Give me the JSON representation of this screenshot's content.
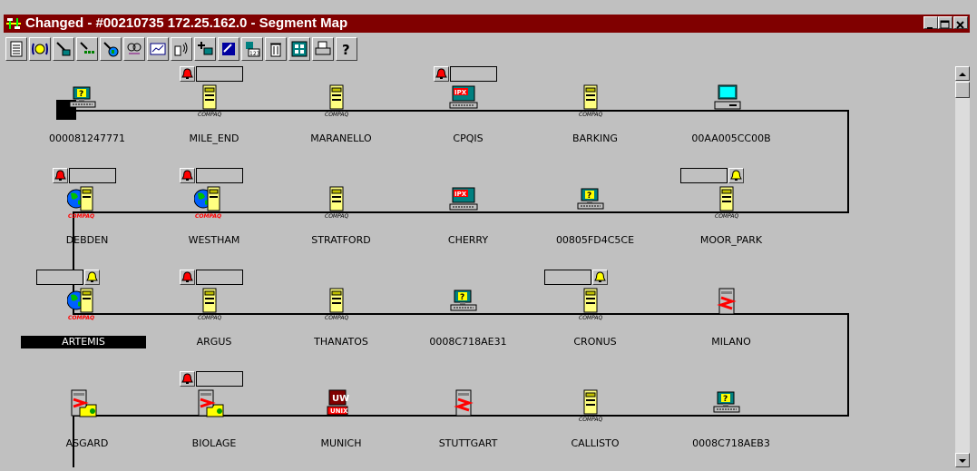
{
  "window": {
    "title": "Changed - #00210735 172.25.162.0 - Segment Map",
    "title_icon": "segment-map-icon",
    "controls": [
      "minimize-icon",
      "maximize-icon",
      "close-icon"
    ]
  },
  "toolbar": {
    "buttons": [
      {
        "icon": "list-icon"
      },
      {
        "icon": "broadcast-icon"
      },
      {
        "icon": "ping-icon"
      },
      {
        "icon": "network-probe-icon"
      },
      {
        "icon": "globe-probe-icon"
      },
      {
        "icon": "discover-icon"
      },
      {
        "icon": "graph-icon"
      },
      {
        "icon": "wireless-device-icon"
      },
      {
        "icon": "add-node-icon"
      },
      {
        "icon": "edit-icon"
      },
      {
        "icon": "numbered-node-icon"
      },
      {
        "icon": "trash-icon"
      },
      {
        "icon": "map-view-icon"
      },
      {
        "icon": "print-icon"
      },
      {
        "icon": "help-icon"
      }
    ]
  },
  "segment": {
    "nodes": [
      {
        "name": "000081247771",
        "icon": "unknown-pc-icon",
        "alarm": "none"
      },
      {
        "name": "MILE_END",
        "icon": "compaq-server-icon",
        "alarm": "red"
      },
      {
        "name": "MARANELLO",
        "icon": "compaq-server-icon",
        "alarm": "none"
      },
      {
        "name": "CPQIS",
        "icon": "ipx-workstation-icon",
        "alarm": "red"
      },
      {
        "name": "BARKING",
        "icon": "compaq-server-icon",
        "alarm": "none"
      },
      {
        "name": "00AA005CC00B",
        "icon": "desktop-pc-icon",
        "alarm": "none"
      },
      {
        "name": "DEBDEN",
        "icon": "compaq-globe-server-icon",
        "alarm": "red"
      },
      {
        "name": "WESTHAM",
        "icon": "compaq-globe-server-icon",
        "alarm": "red"
      },
      {
        "name": "STRATFORD",
        "icon": "compaq-server-icon",
        "alarm": "none"
      },
      {
        "name": "CHERRY",
        "icon": "ipx-workstation-icon",
        "alarm": "none"
      },
      {
        "name": "00805FD4C5CE",
        "icon": "unknown-pc-icon",
        "alarm": "none"
      },
      {
        "name": "MOOR_PARK",
        "icon": "compaq-server-icon",
        "alarm": "yellow"
      },
      {
        "name": "ARTEMIS",
        "icon": "compaq-globe-server-icon",
        "alarm": "yellow",
        "selected": true
      },
      {
        "name": "ARGUS",
        "icon": "compaq-server-icon",
        "alarm": "red"
      },
      {
        "name": "THANATOS",
        "icon": "compaq-server-icon",
        "alarm": "none"
      },
      {
        "name": "0008C718AE31",
        "icon": "unknown-pc-icon",
        "alarm": "none"
      },
      {
        "name": "CRONUS",
        "icon": "compaq-server-icon",
        "alarm": "yellow"
      },
      {
        "name": "MILANO",
        "icon": "red-tower-icon",
        "alarm": "none"
      },
      {
        "name": "ASGARD",
        "icon": "folder-tower-icon",
        "alarm": "none"
      },
      {
        "name": "BIOLAGE",
        "icon": "folder-tower-icon",
        "alarm": "red"
      },
      {
        "name": "MUNICH",
        "icon": "unix-host-icon",
        "alarm": "none"
      },
      {
        "name": "STUTTGART",
        "icon": "red-tower-icon",
        "alarm": "none"
      },
      {
        "name": "CALLISTO",
        "icon": "compaq-server-icon",
        "alarm": "none"
      },
      {
        "name": "0008C718AEB3",
        "icon": "unknown-pc-icon",
        "alarm": "none"
      }
    ]
  },
  "icon_text": {
    "compaq": "COMPAQ",
    "ipx": "IPX",
    "unix": "UNIX",
    "unknown": "?"
  },
  "colors": {
    "titlebar": "#800000",
    "canvas": "#c0c0c0",
    "alarm_red": "#ff0000",
    "alarm_yellow": "#ffff00",
    "line": "#000000"
  }
}
